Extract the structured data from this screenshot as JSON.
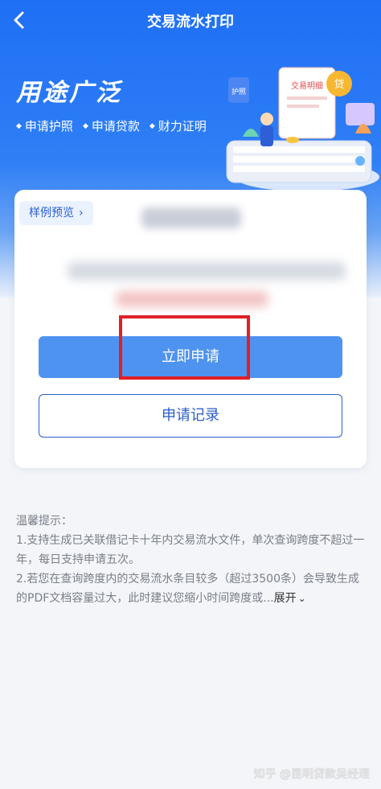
{
  "header": {
    "title": "交易流水打印"
  },
  "hero": {
    "title": "用途广泛",
    "tags": [
      "申请护照",
      "申请贷款",
      "财力证明"
    ],
    "illustration_labels": {
      "passport": "护照",
      "statement": "交易明细",
      "loan": "贷"
    }
  },
  "card": {
    "sample_label": "样例预览"
  },
  "buttons": {
    "apply": "立即申请",
    "records": "申请记录"
  },
  "tips": {
    "title": "温馨提示：",
    "line1": "1.支持生成已关联借记卡十年内交易流水文件，单次查询跨度不超过一年，每日支持申请五次。",
    "line2": "2.若您在查询跨度内的交易流水条目较多（超过3500条）会导致生成的PDF文档容量过大，此时建议您缩小时间跨度或...",
    "expand": "展开"
  },
  "watermark": "知乎 @昆明贷款吴经理",
  "colors": {
    "primary": "#1f6ff5",
    "button": "#4f93f0",
    "highlight": "#e11f25"
  },
  "icons": {
    "back": "chevron-left-icon",
    "sample_chevron": "chevron-right-icon",
    "expand": "double-chevron-down-icon"
  }
}
